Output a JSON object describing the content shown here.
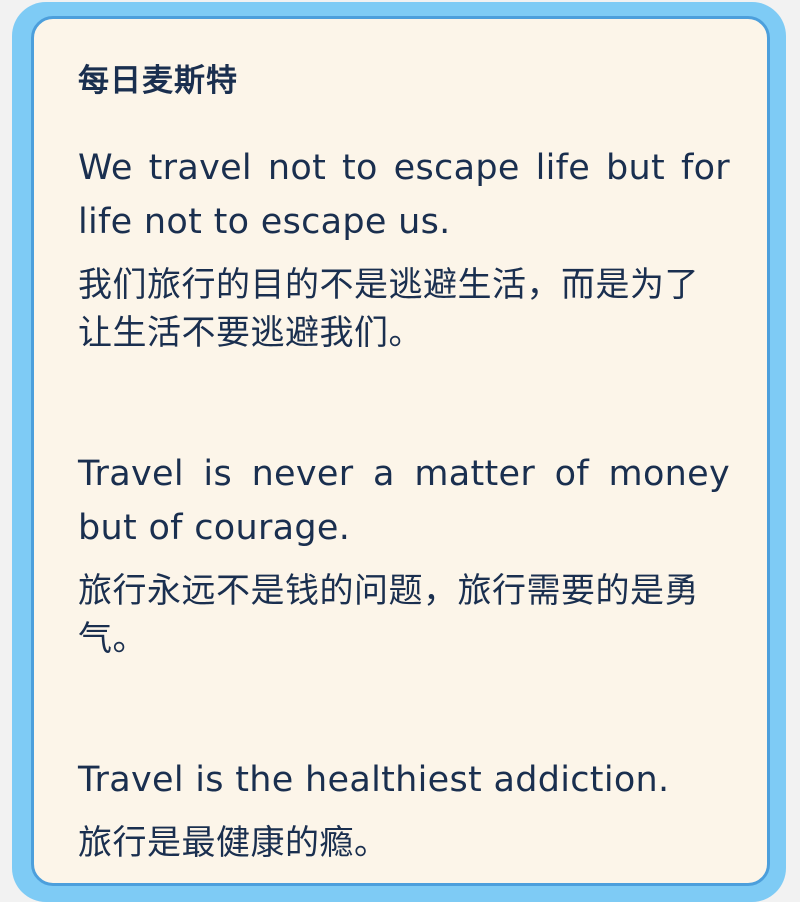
{
  "card": {
    "title": "每日麦斯特",
    "quotes": [
      {
        "en": "We travel not to escape life but for life not to escape us.",
        "zh": "我们旅行的目的不是逃避生活，而是为了让生活不要逃避我们。"
      },
      {
        "en": "Travel is never a matter of money but of courage.",
        "zh": "旅行永远不是钱的问题，旅行需要的是勇气。"
      },
      {
        "en": "Travel is the healthiest addiction.",
        "zh": "旅行是最健康的瘾。"
      }
    ]
  },
  "colors": {
    "outer_frame": "#7ecbf5",
    "card_border": "#4c9fdc",
    "card_background": "#fcf5e9",
    "text": "#1a2f4f"
  }
}
